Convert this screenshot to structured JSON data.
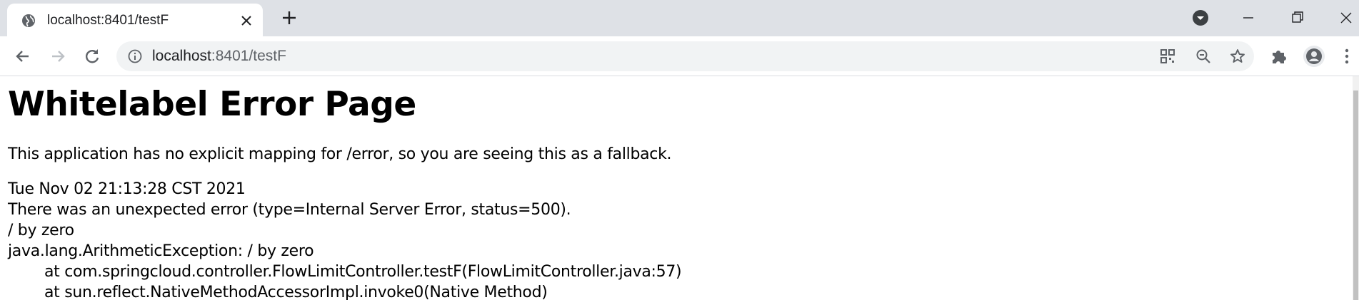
{
  "browser": {
    "tab": {
      "title": "localhost:8401/testF"
    },
    "address_bar": {
      "host": "localhost",
      "rest": ":8401/testF"
    },
    "icons": {
      "favicon": "globe-icon",
      "tab_close": "close-icon",
      "new_tab": "plus-icon",
      "tab_search": "chevron-down-icon",
      "back": "arrow-left-icon",
      "forward": "arrow-right-icon",
      "reload": "reload-icon",
      "site_info": "info-icon",
      "qr": "qr-code-icon",
      "zoom": "zoom-out-icon",
      "bookmark": "star-icon",
      "extensions": "puzzle-icon",
      "profile": "avatar-icon",
      "menu": "kebab-menu-icon"
    },
    "colors": {
      "tabstrip_bg": "#dee1e6",
      "omnibox_bg": "#f1f3f4",
      "icon": "#5f6368"
    }
  },
  "page": {
    "heading": "Whitelabel Error Page",
    "message": "This application has no explicit mapping for /error, so you are seeing this as a fallback.",
    "timestamp": "Tue Nov 02 21:13:28 CST 2021",
    "error_summary": "There was an unexpected error (type=Internal Server Error, status=500).",
    "error_message": "/ by zero",
    "exception": "java.lang.ArithmeticException: / by zero",
    "stack": [
      "at com.springcloud.controller.FlowLimitController.testF(FlowLimitController.java:57)",
      "at sun.reflect.NativeMethodAccessorImpl.invoke0(Native Method)"
    ]
  }
}
